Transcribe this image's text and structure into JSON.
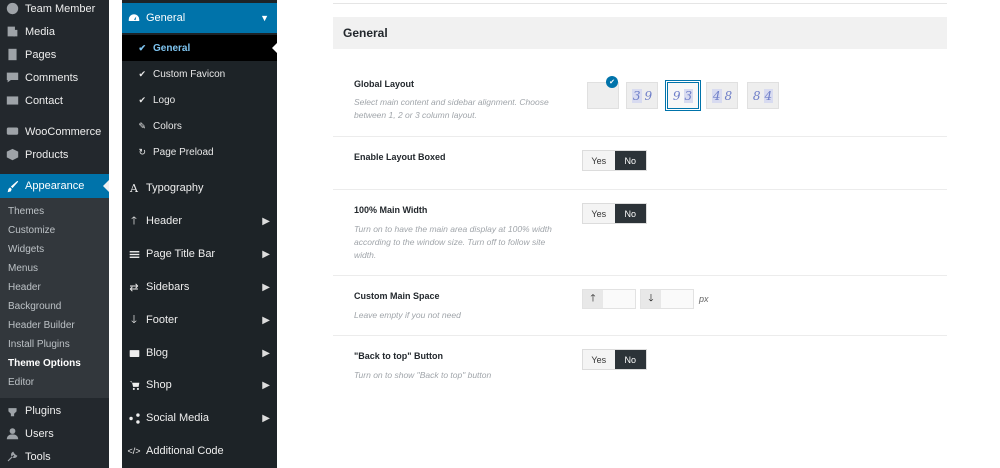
{
  "wp_menu": {
    "items": [
      {
        "label": "Team Member",
        "icon": "team-member-icon"
      },
      {
        "label": "Media",
        "icon": "media-icon"
      },
      {
        "label": "Pages",
        "icon": "pages-icon"
      },
      {
        "label": "Comments",
        "icon": "comments-icon"
      },
      {
        "label": "Contact",
        "icon": "contact-icon"
      },
      {
        "label": "WooCommerce",
        "icon": "woocommerce-icon"
      },
      {
        "label": "Products",
        "icon": "products-icon"
      },
      {
        "label": "Appearance",
        "icon": "appearance-icon"
      },
      {
        "label": "Plugins",
        "icon": "plugins-icon"
      },
      {
        "label": "Users",
        "icon": "users-icon"
      },
      {
        "label": "Tools",
        "icon": "tools-icon"
      }
    ],
    "appearance_sub": [
      "Themes",
      "Customize",
      "Widgets",
      "Menus",
      "Header",
      "Background",
      "Header Builder",
      "Install Plugins",
      "Theme Options",
      "Editor"
    ],
    "active_color": "#0073aa"
  },
  "options_nav": {
    "general": "General",
    "general_sub": [
      "General",
      "Custom Favicon",
      "Logo",
      "Colors",
      "Page Preload"
    ],
    "items": [
      "Typography",
      "Header",
      "Page Title Bar",
      "Sidebars",
      "Footer",
      "Blog",
      "Shop",
      "Social Media",
      "Additional Code"
    ]
  },
  "section": {
    "title": "General"
  },
  "settings": {
    "global_layout": {
      "title": "Global Layout",
      "desc": "Select main content and sidebar alignment. Choose between 1, 2 or 3 column layout.",
      "options": [
        {
          "left": "",
          "right": ""
        },
        {
          "left": "3",
          "right": "9"
        },
        {
          "left": "9",
          "right": "3"
        },
        {
          "left": "4",
          "right": "8"
        },
        {
          "left": "8",
          "right": "4"
        }
      ],
      "selected": "9 3"
    },
    "layout_boxed": {
      "title": "Enable Layout Boxed",
      "yes": "Yes",
      "no": "No",
      "value": "No"
    },
    "main_width": {
      "title": "100% Main Width",
      "desc": "Turn on to have the main area display at 100% width according to the window size. Turn off to follow site width.",
      "yes": "Yes",
      "no": "No",
      "value": "No"
    },
    "main_space": {
      "title": "Custom Main Space",
      "desc": "Leave empty if you not need",
      "top_value": "",
      "bottom_value": "",
      "unit": "px"
    },
    "back_to_top": {
      "title": "\"Back to top\" Button",
      "desc": "Turn on to show \"Back to top\" button",
      "yes": "Yes",
      "no": "No",
      "value": "No"
    }
  }
}
